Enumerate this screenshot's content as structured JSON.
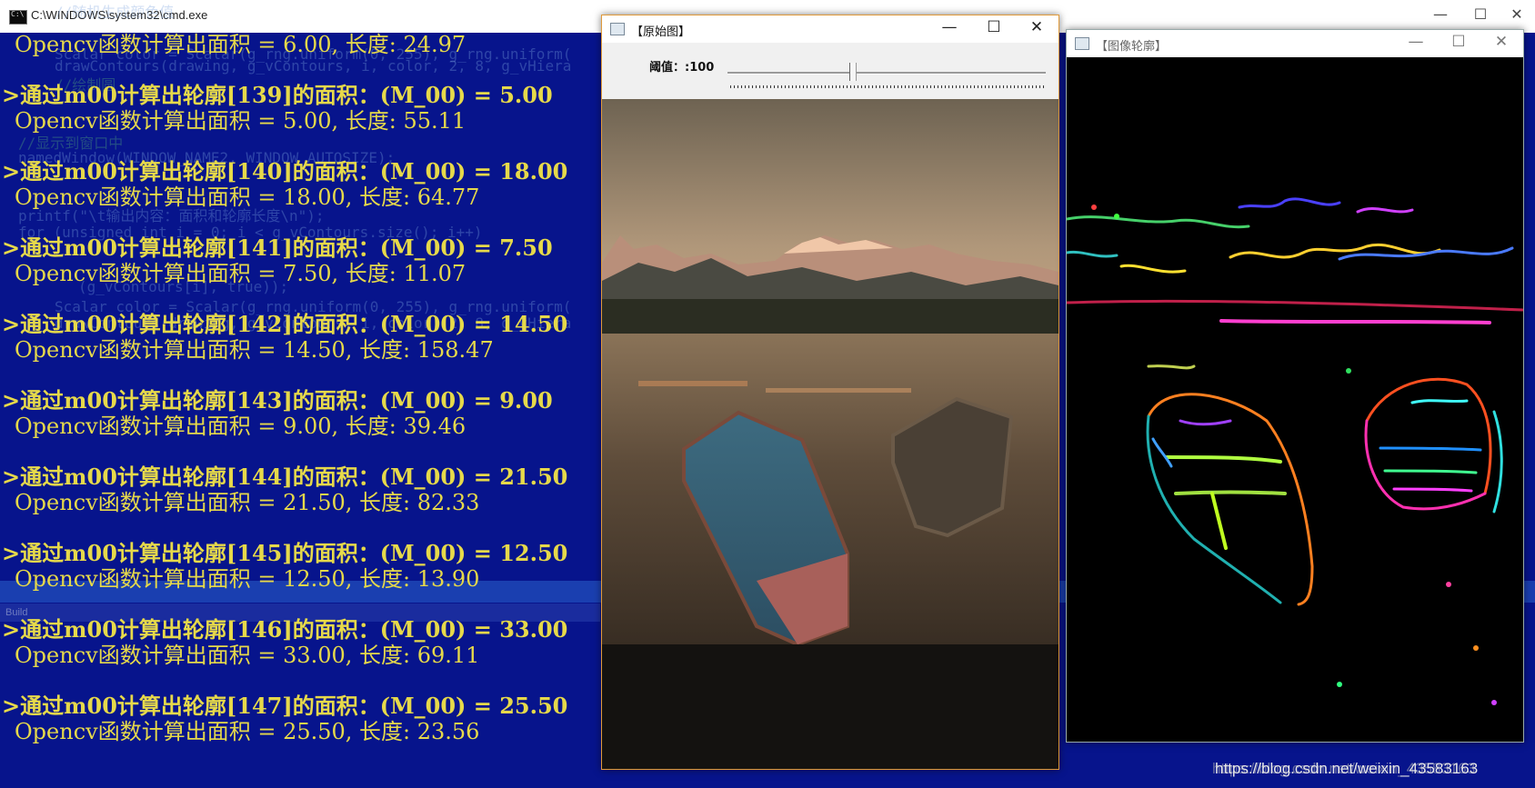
{
  "cmd_window": {
    "title": "C:\\WINDOWS\\system32\\cmd.exe",
    "minimize": "—",
    "maximize": "☐",
    "close": "✕"
  },
  "background_code": [
    "//随机生成颜色值",
    "Scalar color = Scalar(g_rng.uniform(0, 255), g_rng.uniform(",
    "drawContours(drawing, g_vContours, i, color, 2, 8, g_vHiera",
    "//绘制圆",
    "//显示到窗口中",
    "namedWindow(WINDOW_NAME2, WINDOW_AUTOSIZE);",
    "printf(\"\\t输出内容：面积和轮廓长度\\n\");",
    "for (unsigned int i = 0; i < g_vContours.size(); i++)",
    "(g_vContours[i], true));",
    "Scalar color = Scalar(g_rng.uniform(0, 255), g_rng.uniform(",
    "drawContours(drawing, g_vContours, i, color, 2, 8, g_vHiera"
  ],
  "build_label": "Build",
  "console": [
    {
      "m00": "",
      "area": "Opencv函数计算出面积 = 6.00, 长度: 24.97"
    },
    {
      "m00": ">通过m00计算出轮廓[139]的面积：(M_00) = 5.00",
      "area": "Opencv函数计算出面积 = 5.00, 长度: 55.11"
    },
    {
      "m00": ">通过m00计算出轮廓[140]的面积：(M_00) = 18.00",
      "area": "Opencv函数计算出面积 = 18.00, 长度: 64.77"
    },
    {
      "m00": ">通过m00计算出轮廓[141]的面积：(M_00) = 7.50",
      "area": "Opencv函数计算出面积 = 7.50, 长度: 11.07"
    },
    {
      "m00": ">通过m00计算出轮廓[142]的面积：(M_00) = 14.50",
      "area": "Opencv函数计算出面积 = 14.50, 长度: 158.47"
    },
    {
      "m00": ">通过m00计算出轮廓[143]的面积：(M_00) = 9.00",
      "area": "Opencv函数计算出面积 = 9.00, 长度: 39.46"
    },
    {
      "m00": ">通过m00计算出轮廓[144]的面积：(M_00) = 21.50",
      "area": "Opencv函数计算出面积 = 21.50, 长度: 82.33"
    },
    {
      "m00": ">通过m00计算出轮廓[145]的面积：(M_00) = 12.50",
      "area": "Opencv函数计算出面积 = 12.50, 长度: 13.90"
    },
    {
      "m00": ">通过m00计算出轮廓[146]的面积：(M_00) = 33.00",
      "area": "Opencv函数计算出面积 = 33.00, 长度: 69.11"
    },
    {
      "m00": ">通过m00计算出轮廓[147]的面积：(M_00) = 25.50",
      "area": "Opencv函数计算出面积 = 25.50, 长度: 23.56"
    }
  ],
  "original_window": {
    "title": "【原始图】",
    "trackbar_label": "阈值：:100",
    "trackbar_value": 100,
    "trackbar_max": 255,
    "minimize": "—",
    "maximize": "☐",
    "close": "✕"
  },
  "contour_window": {
    "title": "【图像轮廓】",
    "minimize": "—",
    "maximize": "☐",
    "close": "✕"
  },
  "watermark": "https://blog.csdn.net/weixin_43583163",
  "colors": {
    "console_bg": "#07148c",
    "console_text": "#e6d94a",
    "highlight": "#1a3fb0"
  }
}
